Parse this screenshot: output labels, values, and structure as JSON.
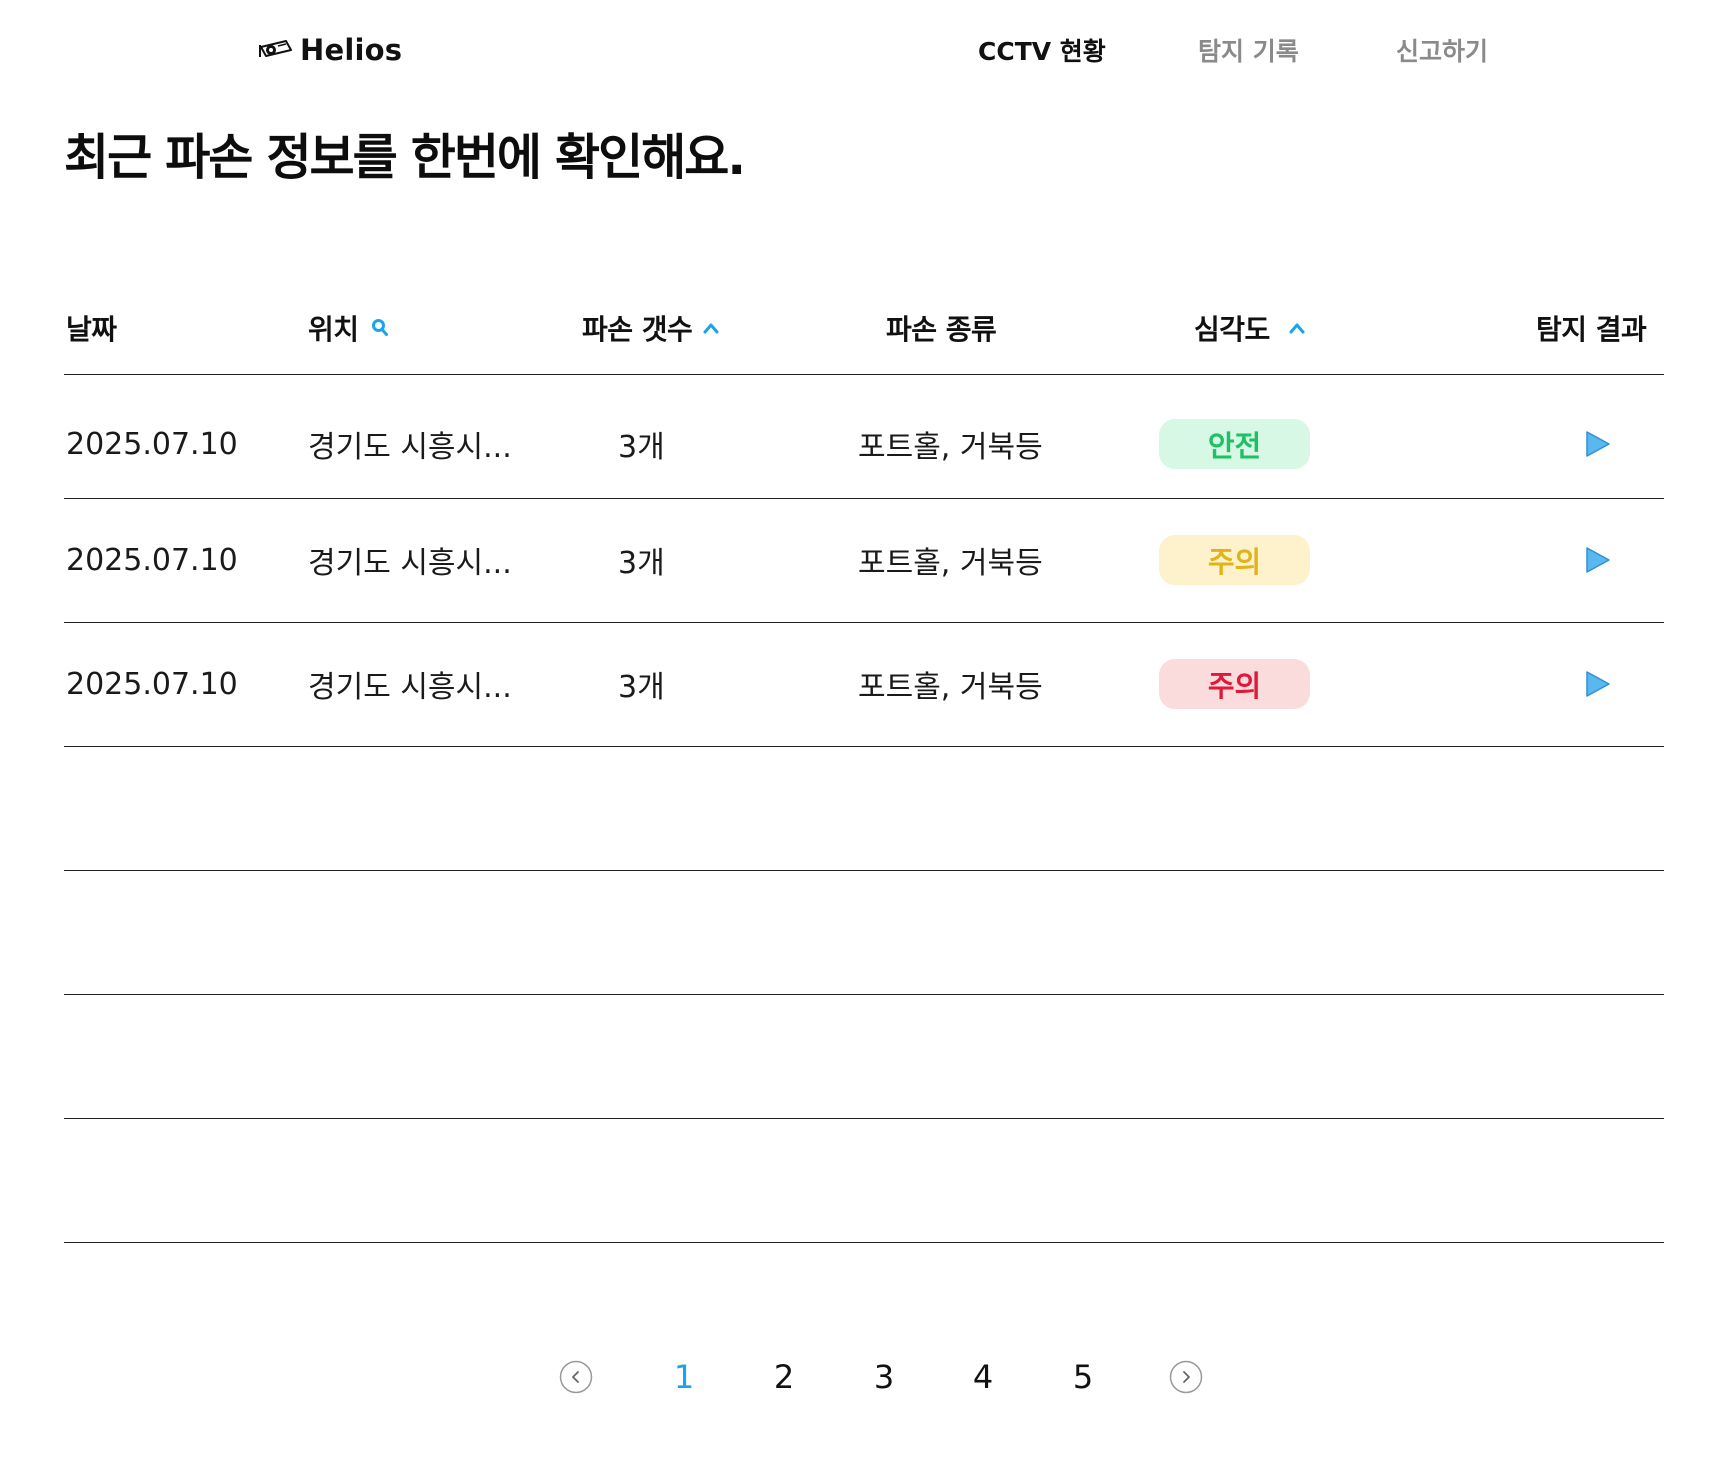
{
  "header": {
    "logo_text": "Helios",
    "nav": [
      {
        "label": "CCTV 현황",
        "active": true
      },
      {
        "label": "탐지 기록",
        "active": false
      },
      {
        "label": "신고하기",
        "active": false
      }
    ]
  },
  "title": "최근 파손 정보를 한번에 확인해요.",
  "table": {
    "columns": {
      "date": "날짜",
      "location": "위치",
      "count": "파손 갯수",
      "type": "파손 종류",
      "severity": "심각도",
      "result": "탐지 결과"
    },
    "rows": [
      {
        "date": "2025.07.10",
        "location": "경기도 시흥시...",
        "count": "3개",
        "type": "포트홀, 거북등",
        "severity": "안전"
      },
      {
        "date": "2025.07.10",
        "location": "경기도 시흥시...",
        "count": "3개",
        "type": "포트홀, 거북등",
        "severity": "주의"
      },
      {
        "date": "2025.07.10",
        "location": "경기도 시흥시...",
        "count": "3개",
        "type": "포트홀, 거북등",
        "severity": "주의"
      }
    ]
  },
  "pagination": {
    "pages": [
      "1",
      "2",
      "3",
      "4",
      "5"
    ],
    "current": "1"
  },
  "colors": {
    "accent": "#1aa3ee",
    "play": "#5bb8ee",
    "badge_safe_bg": "#d6f8e4",
    "badge_safe_text": "#1fbf66",
    "badge_warn_bg": "#fdf2cc",
    "badge_warn_text": "#e0b31a",
    "badge_danger_bg": "#fbdcdc",
    "badge_danger_text": "#e0183a",
    "nav_inactive": "#8a8a8a"
  },
  "icons": {
    "logo": "cctv-camera-icon",
    "location_search": "search-icon",
    "count_sort": "chevron-up-icon",
    "severity_sort": "chevron-up-icon",
    "row_action": "play-icon",
    "pager_prev": "chevron-left-circle-icon",
    "pager_next": "chevron-right-circle-icon"
  }
}
